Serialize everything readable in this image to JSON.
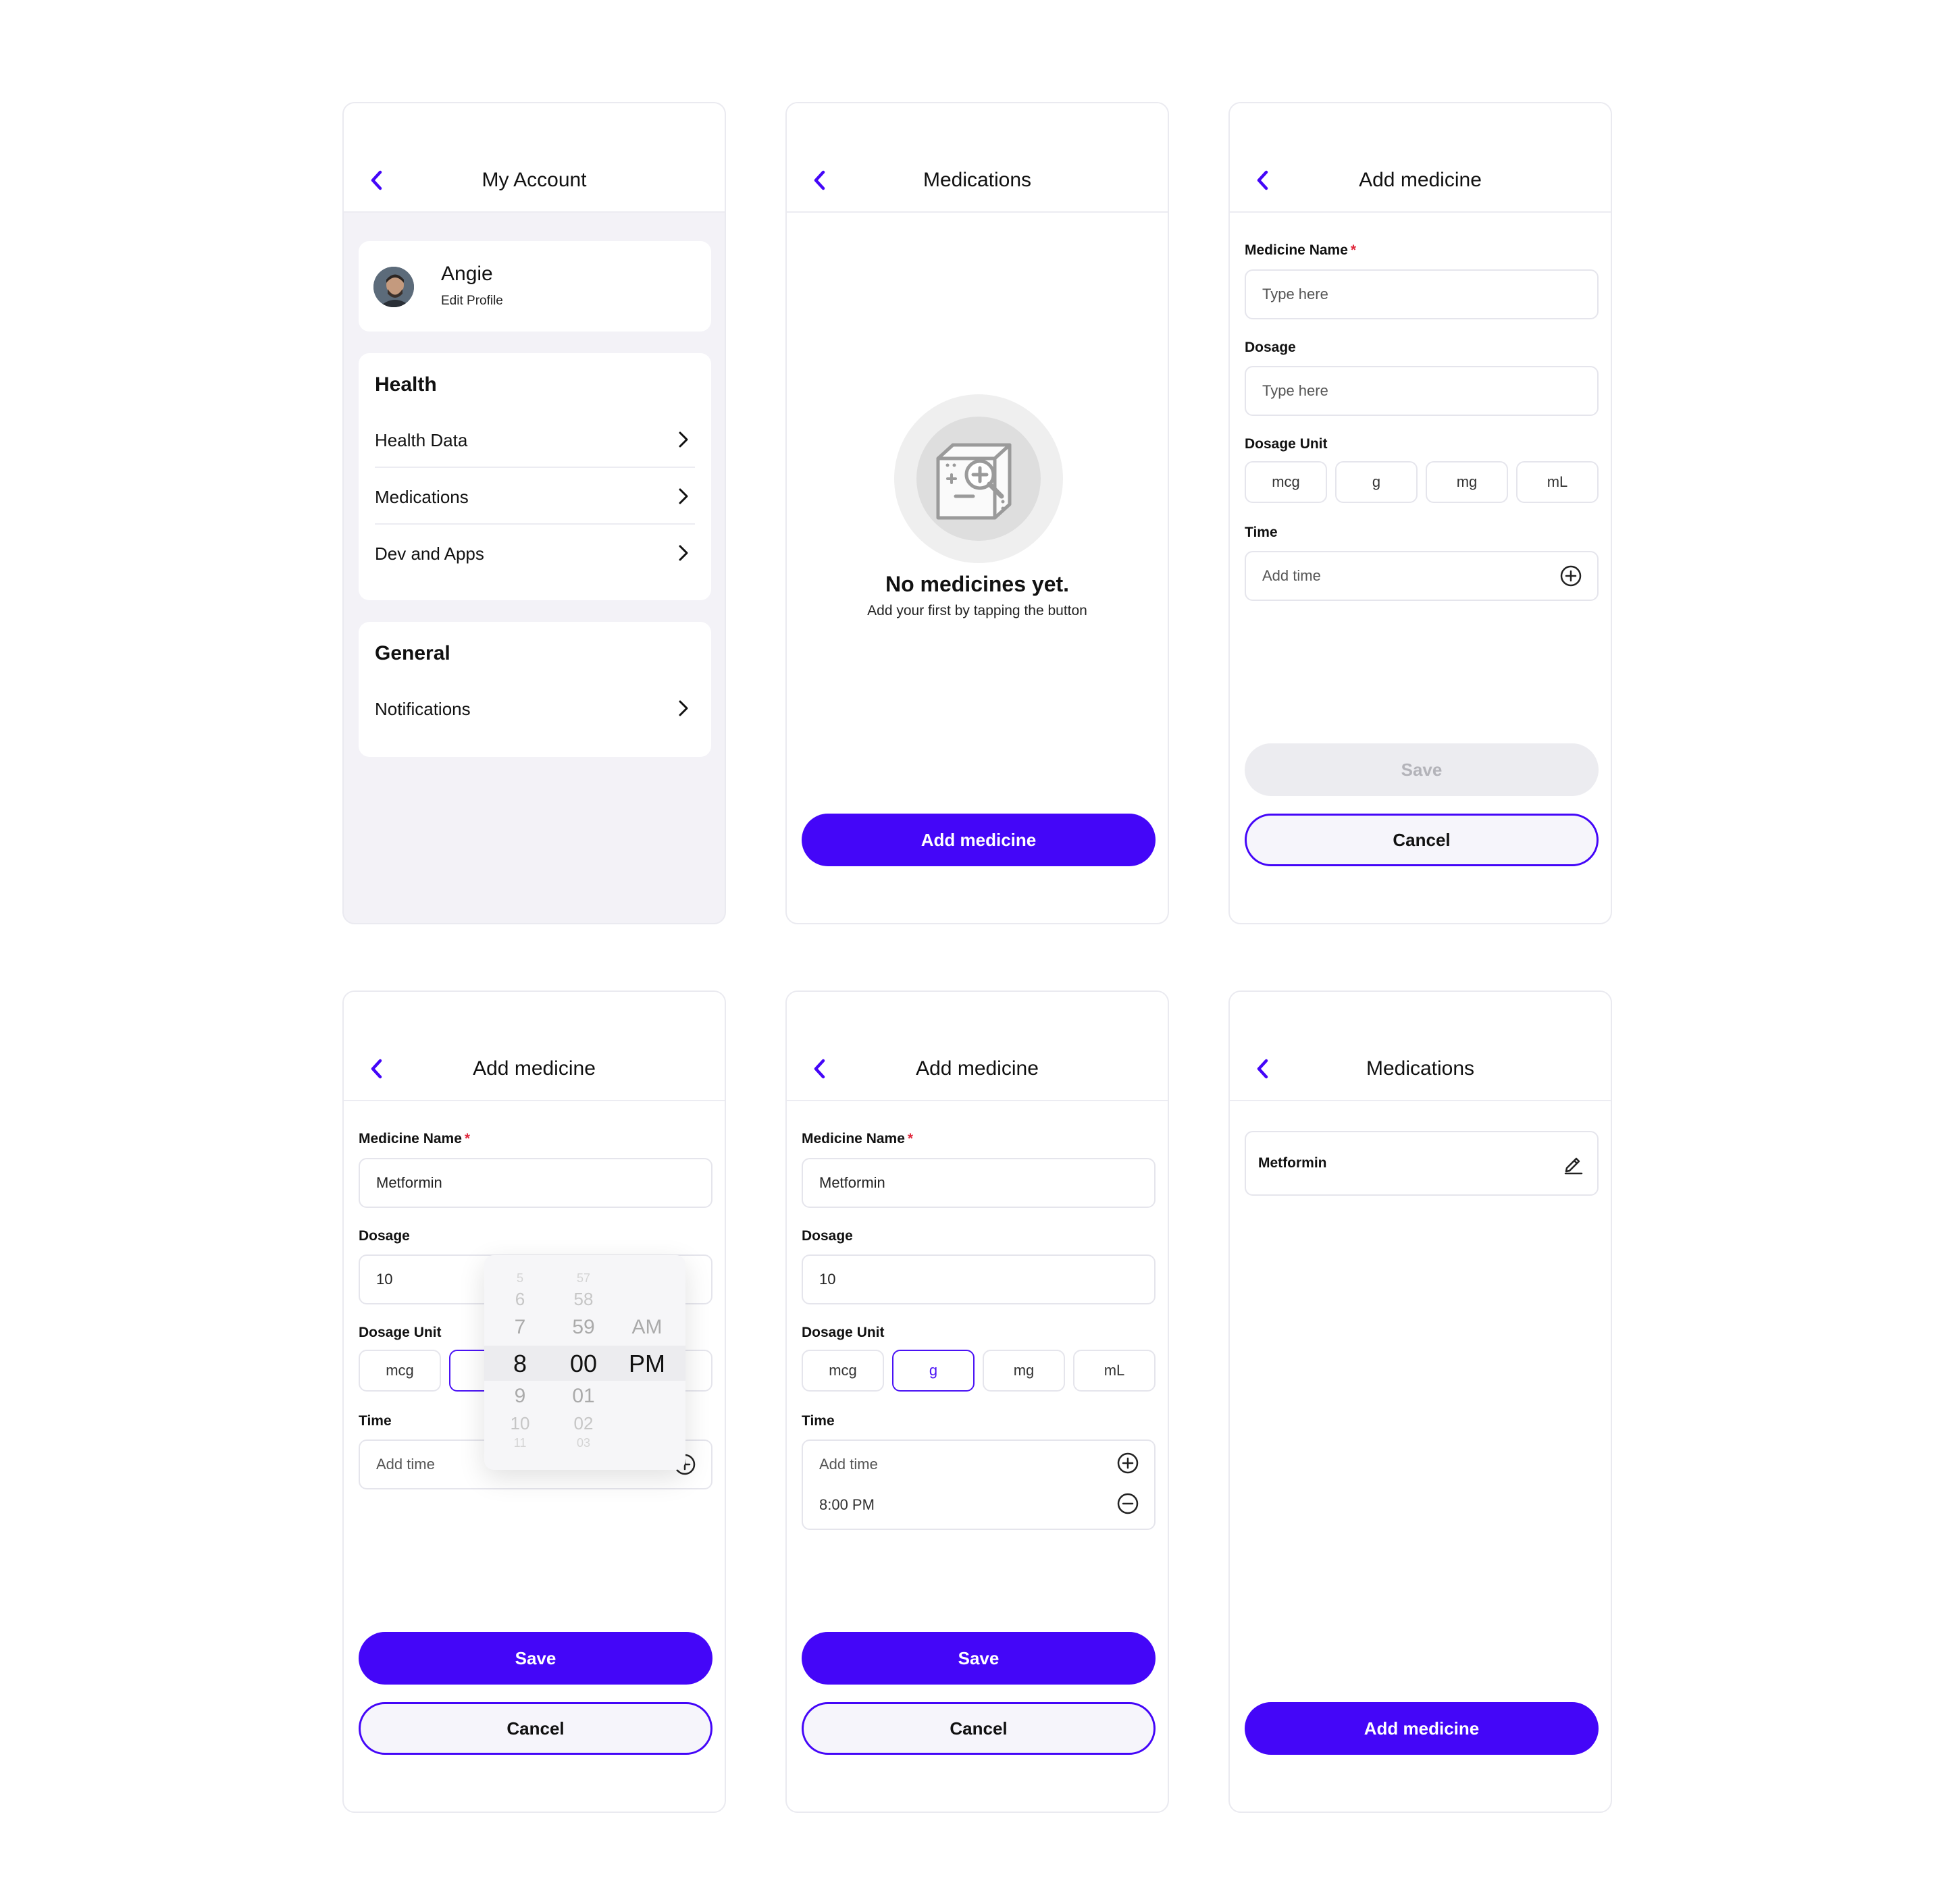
{
  "colors": {
    "accent": "#4406f8",
    "required": "#e0283c"
  },
  "account": {
    "title": "My Account",
    "user_name": "Angie",
    "edit_profile": "Edit Profile",
    "health_title": "Health",
    "health_items": [
      "Health Data",
      "Medications",
      "Dev and Apps"
    ],
    "general_title": "General",
    "general_items": [
      "Notifications"
    ]
  },
  "medications_empty": {
    "title": "Medications",
    "empty_title": "No medicines yet.",
    "empty_sub": "Add your first by tapping the button",
    "add_button": "Add medicine"
  },
  "add_empty": {
    "title": "Add medicine",
    "name_label": "Medicine Name",
    "required_mark": "*",
    "name_placeholder": "Type here",
    "dosage_label": "Dosage",
    "dosage_placeholder": "Type here",
    "unit_label": "Dosage Unit",
    "units": [
      "mcg",
      "g",
      "mg",
      "mL"
    ],
    "time_label": "Time",
    "time_placeholder": "Add time",
    "save": "Save",
    "cancel": "Cancel"
  },
  "add_picker": {
    "title": "Add medicine",
    "name_label": "Medicine Name",
    "required_mark": "*",
    "name_value": "Metformin",
    "dosage_label": "Dosage",
    "dosage_value": "10",
    "unit_label": "Dosage Unit",
    "units": [
      "mcg",
      "g",
      "mg",
      "mL"
    ],
    "time_label": "Time",
    "time_placeholder": "Add time",
    "picker": {
      "hours": [
        "5",
        "6",
        "7",
        "8",
        "9",
        "10",
        "11"
      ],
      "minutes": [
        "57",
        "58",
        "59",
        "00",
        "01",
        "02",
        "03"
      ],
      "periods": [
        "AM",
        "PM"
      ],
      "selected_hour": "8",
      "selected_minute": "00",
      "selected_period": "PM"
    },
    "save": "Save",
    "cancel": "Cancel"
  },
  "add_filled": {
    "title": "Add medicine",
    "name_label": "Medicine Name",
    "required_mark": "*",
    "name_value": "Metformin",
    "dosage_label": "Dosage",
    "dosage_value": "10",
    "unit_label": "Dosage Unit",
    "units": [
      "mcg",
      "g",
      "mg",
      "mL"
    ],
    "selected_unit": "g",
    "time_label": "Time",
    "time_placeholder": "Add time",
    "time_entry": "8:00 PM",
    "save": "Save",
    "cancel": "Cancel"
  },
  "medications_list": {
    "title": "Medications",
    "items": [
      "Metformin"
    ],
    "add_button": "Add medicine"
  }
}
